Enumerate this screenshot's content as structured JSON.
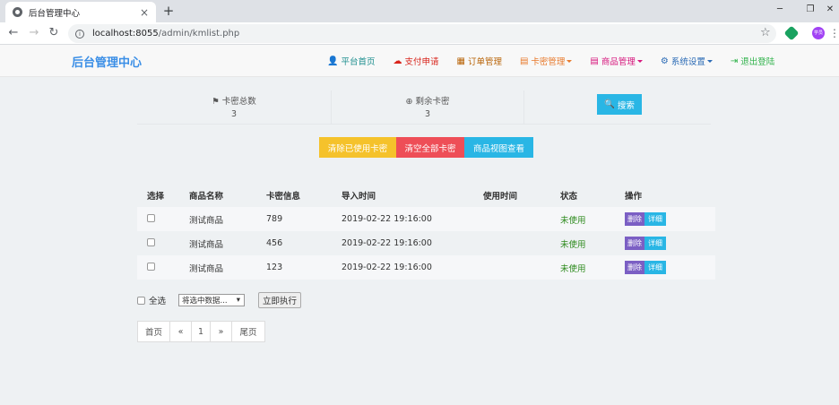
{
  "browser": {
    "tab_title": "后台管理中心",
    "close_glyph": "×",
    "newtab_glyph": "+",
    "url_host": "localhost:8055",
    "url_path": "/admin/kmlist.php",
    "avatar_text": "学员"
  },
  "navbar": {
    "brand": "后台管理中心",
    "links": [
      {
        "label": "平台首页",
        "icon": "user-icon",
        "color": "#1f8f8f"
      },
      {
        "label": "支付申请",
        "icon": "cloud-icon",
        "color": "#d9251c"
      },
      {
        "label": "订单管理",
        "icon": "calendar-icon",
        "color": "#b9650a"
      },
      {
        "label": "卡密管理",
        "icon": "list-icon",
        "color": "#e8792b",
        "dropdown": true
      },
      {
        "label": "商品管理",
        "icon": "list-icon",
        "color": "#d6157c",
        "dropdown": true
      },
      {
        "label": "系统设置",
        "icon": "gear-icon",
        "color": "#2a6ab5",
        "dropdown": true
      },
      {
        "label": "退出登陆",
        "icon": "logout-icon",
        "color": "#2fb24a"
      }
    ]
  },
  "stats": {
    "total_label": "卡密总数",
    "total_value": "3",
    "remain_label": "剩余卡密",
    "remain_value": "3"
  },
  "search_label": "搜索",
  "actions": {
    "clear_used": "清除已使用卡密",
    "clear_all": "清空全部卡密",
    "view_product": "商品视图查看"
  },
  "table": {
    "headers": [
      "选择",
      "商品名称",
      "卡密信息",
      "导入时间",
      "使用时间",
      "状态",
      "操作"
    ],
    "rows": [
      {
        "product": "测试商品",
        "card": "789",
        "import_time": "2019-02-22 19:16:00",
        "use_time": "",
        "status": "未使用"
      },
      {
        "product": "测试商品",
        "card": "456",
        "import_time": "2019-02-22 19:16:00",
        "use_time": "",
        "status": "未使用"
      },
      {
        "product": "测试商品",
        "card": "123",
        "import_time": "2019-02-22 19:16:00",
        "use_time": "",
        "status": "未使用"
      }
    ],
    "delete_label": "删除",
    "detail_label": "详细"
  },
  "bulk": {
    "select_all": "全选",
    "select_value": "将选中数据...",
    "execute": "立即执行"
  },
  "pager": {
    "first": "首页",
    "prev": "«",
    "current": "1",
    "next": "»",
    "last": "尾页"
  },
  "colors": {
    "search": "#29b6e5",
    "clear_used": "#f5c22b",
    "clear_all": "#ee4e57",
    "view_product": "#29b6e5"
  }
}
